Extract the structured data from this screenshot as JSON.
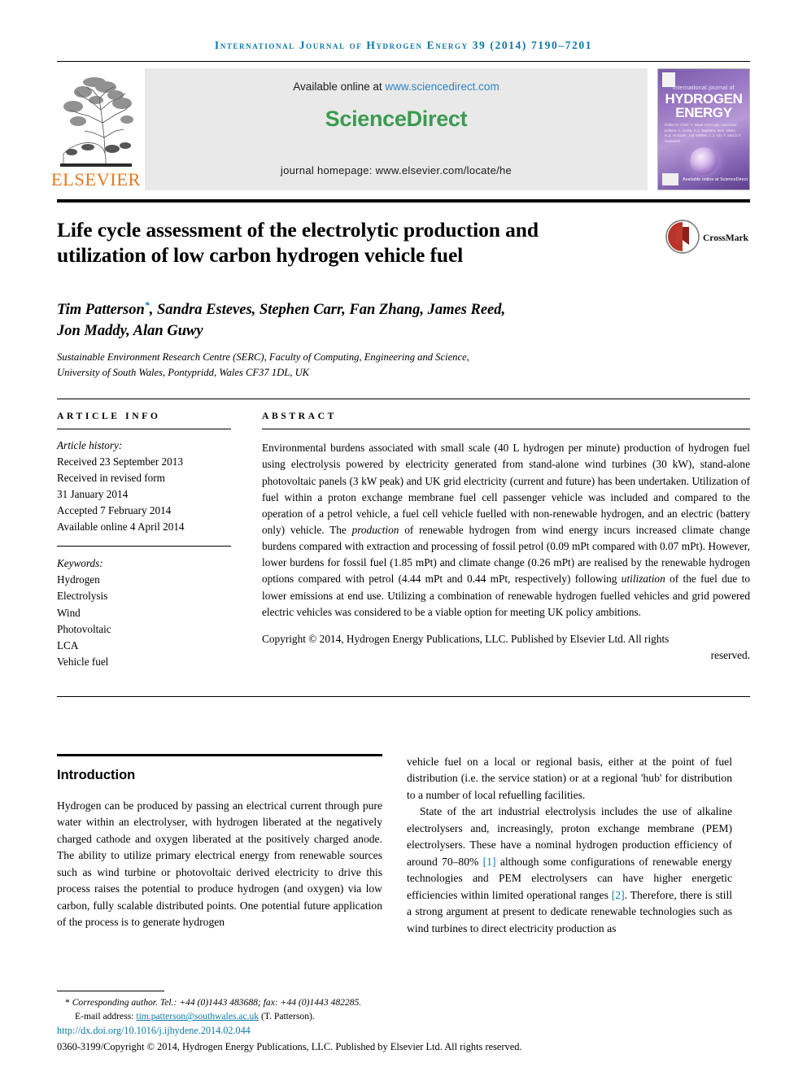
{
  "running_head": "International Journal of Hydrogen Energy 39 (2014) 7190–7201",
  "masthead": {
    "publisher_name": "ELSEVIER",
    "available_prefix": "Available online at ",
    "available_url": "www.sciencedirect.com",
    "sciencedirect_logo": "ScienceDirect",
    "journal_homepage": "journal homepage: www.elsevier.com/locate/he",
    "cover": {
      "eyebrow": "international journal of",
      "title_line1": "HYDROGEN",
      "title_line2": "ENERGY",
      "editors": "Editor-in-Chief: T. Nejat Veziroglu\nAssociate Editors: A. Dutta, S.Z. Baykara, M.R. Islam, H.Z. Hussain, J.M. Mellen, L.J. Lin, T. and D.Y. Goswami",
      "sciencedirect_badge": "Available online at\nScienceDirect"
    }
  },
  "article": {
    "title": "Life cycle assessment of the electrolytic production and utilization of low carbon hydrogen vehicle fuel",
    "crossmark_label": "CrossMark",
    "authors": "Tim Patterson*, Sandra Esteves, Stephen Carr, Fan Zhang, James Reed, Jon Maddy, Alan Guwy",
    "authors_line1": "Tim Patterson",
    "authors_marker": "*",
    "authors_line1_rest": ", Sandra Esteves, Stephen Carr, Fan Zhang, James Reed,",
    "authors_line2": "Jon Maddy, Alan Guwy",
    "affiliation_line1": "Sustainable Environment Research Centre (SERC), Faculty of Computing, Engineering and Science,",
    "affiliation_line2": "University of South Wales, Pontypridd, Wales CF37 1DL, UK"
  },
  "article_info": {
    "heading": "ARTICLE INFO",
    "history_label": "Article history:",
    "history": [
      "Received 23 September 2013",
      "Received in revised form",
      "31 January 2014",
      "Accepted 7 February 2014",
      "Available online 4 April 2014"
    ],
    "keywords_label": "Keywords:",
    "keywords": [
      "Hydrogen",
      "Electrolysis",
      "Wind",
      "Photovoltaic",
      "LCA",
      "Vehicle fuel"
    ]
  },
  "abstract": {
    "heading": "ABSTRACT",
    "part1": "Environmental burdens associated with small scale (40 L hydrogen per minute) production of hydrogen fuel using electrolysis powered by electricity generated from stand-alone wind turbines (30 kW), stand-alone photovoltaic panels (3 kW peak) and UK grid electricity (current and future) has been undertaken. Utilization of fuel within a proton exchange membrane fuel cell passenger vehicle was included and compared to the operation of a petrol vehicle, a fuel cell vehicle fuelled with non-renewable hydrogen, and an electric (battery only) vehicle. The ",
    "italic1": "production",
    "part2": " of renewable hydrogen from wind energy incurs increased climate change burdens compared with extraction and processing of fossil petrol (0.09 mPt compared with 0.07 mPt). However, lower burdens for fossil fuel (1.85 mPt) and climate change (0.26 mPt) are realised by the renewable hydrogen options compared with petrol (4.44 mPt and 0.44 mPt, respectively) following ",
    "italic2": "utilization",
    "part3": " of the fuel due to lower emissions at end use. Utilizing a combination of renewable hydrogen fuelled vehicles and grid powered electric vehicles was considered to be a viable option for meeting UK policy ambitions.",
    "copyright_main": "Copyright © 2014, Hydrogen Energy Publications, LLC. Published by Elsevier Ltd. All rights",
    "copyright_tail": "reserved."
  },
  "body": {
    "section_heading": "Introduction",
    "left_paragraph": "Hydrogen can be produced by passing an electrical current through pure water within an electrolyser, with hydrogen liberated at the negatively charged cathode and oxygen liberated at the positively charged anode. The ability to utilize primary electrical energy from renewable sources such as wind turbine or photovoltaic derived electricity to drive this process raises the potential to produce hydrogen (and oxygen) via low carbon, fully scalable distributed points. One potential future application of the process is to generate hydrogen",
    "right_paragraph_1": "vehicle fuel on a local or regional basis, either at the point of fuel distribution (i.e. the service station) or at a regional 'hub' for distribution to a number of local refuelling facilities.",
    "right_paragraph_2a": "State of the art industrial electrolysis includes the use of alkaline electrolysers and, increasingly, proton exchange membrane (PEM) electrolysers. These have a nominal hydrogen production efficiency of around 70–80% ",
    "right_ref_1": "[1]",
    "right_paragraph_2b": " although some configurations of renewable energy technologies and PEM electrolysers can have higher energetic efficiencies within limited operational ranges ",
    "right_ref_2": "[2]",
    "right_paragraph_2c": ". Therefore, there is still a strong argument at present to dedicate renewable technologies such as wind turbines to direct electricity production as"
  },
  "footnote": {
    "corresponding_star": "*",
    "corresponding": "Corresponding author. Tel.: +44 (0)1443 483688; fax: +44 (0)1443 482285.",
    "email_label": "E-mail address: ",
    "email": "tim.patterson@southwales.ac.uk",
    "email_suffix": " (T. Patterson).",
    "doi": "http://dx.doi.org/10.1016/j.ijhydene.2014.02.044",
    "issn_copyright": "0360-3199/Copyright © 2014, Hydrogen Energy Publications, LLC. Published by Elsevier Ltd. All rights reserved."
  },
  "colors": {
    "link": "#0b79a6",
    "sciencedirect_green": "#3a9b4f",
    "sciencedirect_blue": "#2e84c4",
    "elsevier_orange": "#e87722",
    "banner_gray": "#e9e9e9"
  }
}
